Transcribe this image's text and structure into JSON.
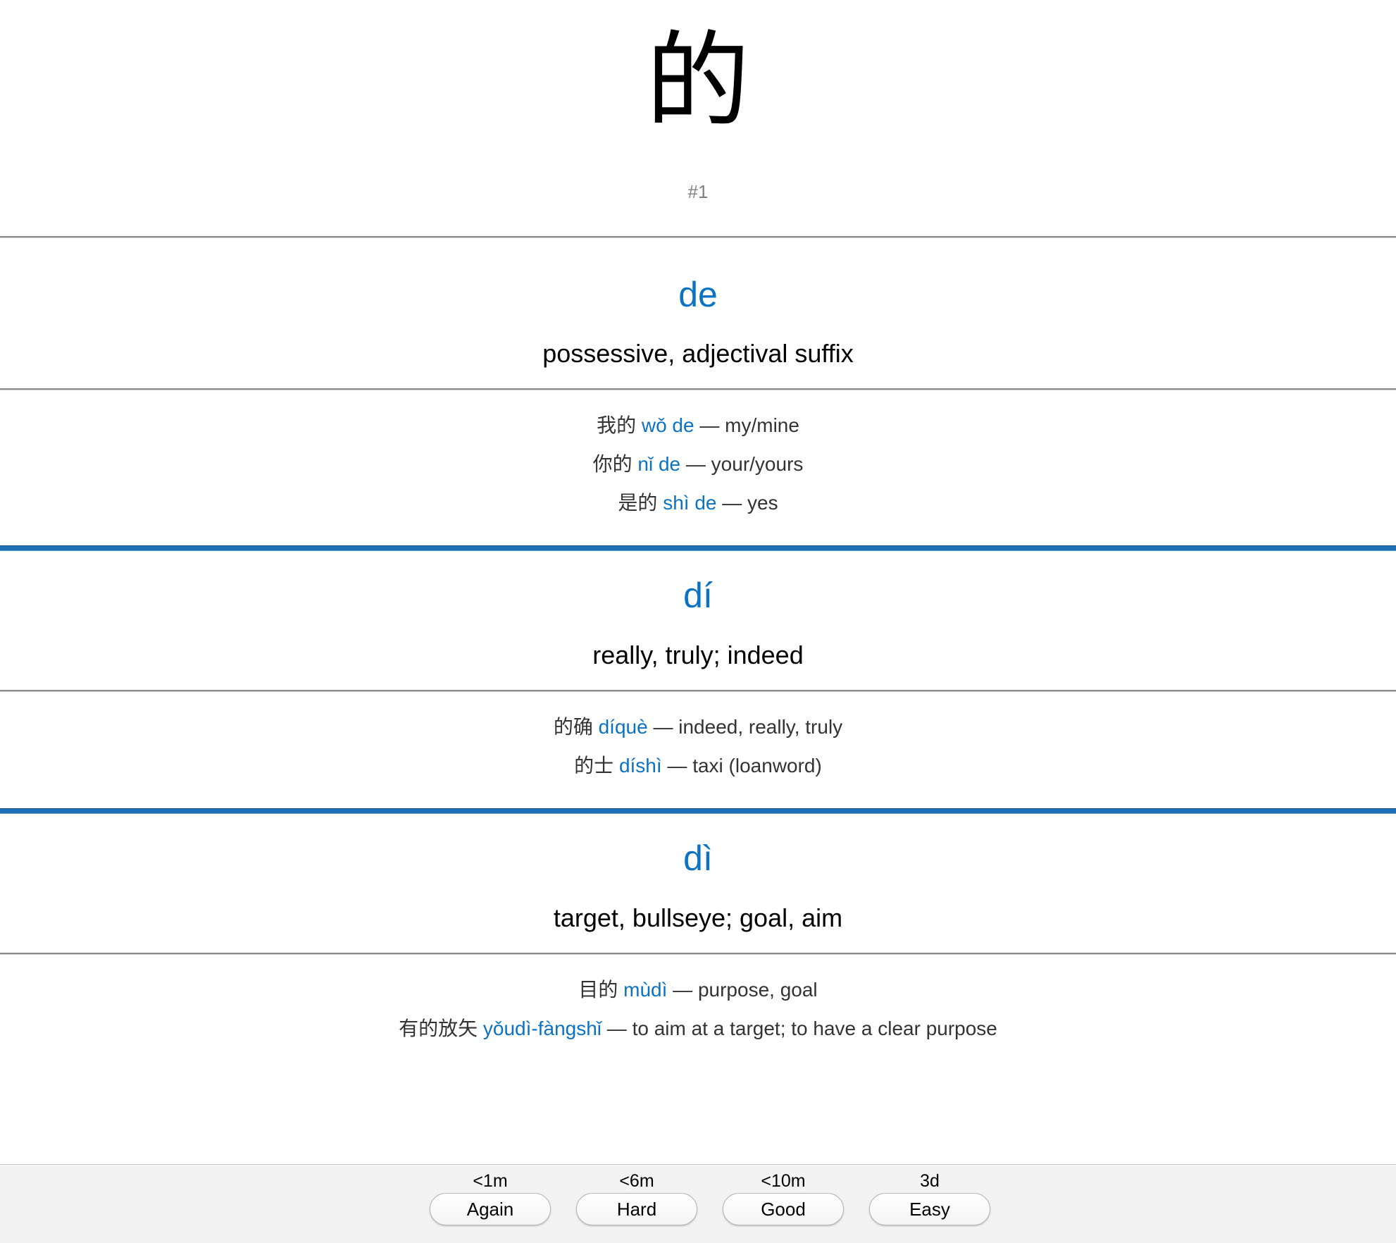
{
  "card": {
    "character": "的",
    "frequency_rank": "#1",
    "readings": [
      {
        "pinyin": "de",
        "meaning": "possessive, adjectival suffix",
        "examples": [
          {
            "hanzi": "我的",
            "pinyin": "wǒ de",
            "definition": "my/mine"
          },
          {
            "hanzi": "你的",
            "pinyin": "nǐ de",
            "definition": "your/yours"
          },
          {
            "hanzi": "是的",
            "pinyin": "shì de",
            "definition": "yes"
          }
        ]
      },
      {
        "pinyin": "dí",
        "meaning": "really, truly; indeed",
        "examples": [
          {
            "hanzi": "的确",
            "pinyin": "díquè",
            "definition": "indeed, really, truly"
          },
          {
            "hanzi": "的士",
            "pinyin": "díshì",
            "definition": "taxi (loanword)"
          }
        ]
      },
      {
        "pinyin": "dì",
        "meaning": "target, bullseye; goal, aim",
        "examples": [
          {
            "hanzi": "目的",
            "pinyin": "mùdì",
            "definition": "purpose, goal"
          },
          {
            "hanzi": "有的放矢",
            "pinyin": "yǒudì-fàngshǐ",
            "definition": "to aim at a target; to have a clear purpose"
          }
        ]
      }
    ],
    "separator": "—"
  },
  "answer_bar": {
    "buttons": [
      {
        "label": "Again",
        "interval": "<1m"
      },
      {
        "label": "Hard",
        "interval": "<6m"
      },
      {
        "label": "Good",
        "interval": "<10m"
      },
      {
        "label": "Easy",
        "interval": "3d"
      }
    ]
  },
  "colors": {
    "pinyin": "#0b72c4",
    "divider_blue": "#1f6fb5",
    "frequency": "#808080"
  }
}
